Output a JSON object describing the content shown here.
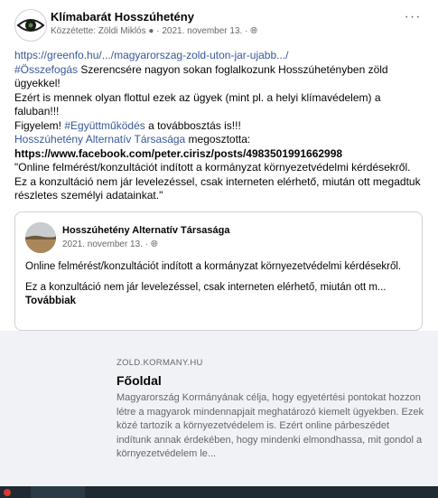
{
  "post": {
    "page_name": "Klímabarát Hosszúhetény",
    "meta_prefix": "Közzétette: ",
    "author": "Zöldi Miklós",
    "date": "2021. november 13.",
    "dot": " · ",
    "link_url": "https://greenfo.hu/.../magyarorszag-zold-uton-jar-ujabb.../",
    "hashtag1": "#Összefogás",
    "line1_rest": " Szerencsére nagyon sokan foglalkozunk Hosszúhetényben zöld ügyekkel!",
    "line2": "Ezért is mennek olyan flottul ezek az ügyek (mint pl. a helyi klímavédelem) a faluban!!!",
    "line3_pre": "Figyelem! ",
    "hashtag2": "#Együttműködés",
    "line3_post": " a továbbosztás is!!!",
    "share_page": "Hosszúhetény Alternatív Társasága",
    "share_suffix": " megosztotta:",
    "fb_link": "https://www.facebook.com/peter.cirisz/posts/4983501991662998",
    "quote": "\"Online felmérést/konzultációt indított a kormányzat környezetvédelmi kérdésekről. Ez a konzultáció nem jár levelezéssel, csak interneten elérhető, miután ott megadtuk részletes személyi adatainkat.\""
  },
  "shared": {
    "name": "Hosszúhetény Alternatív Társasága",
    "date": "2021. november 13.",
    "dot": " · ",
    "para1": "Online felmérést/konzultációt indított a kormányzat környezetvédelmi kérdésekről.",
    "para2": "Ez a konzultáció nem jár levelezéssel, csak interneten elérhető, miután ott m...",
    "more": "Továbbiak"
  },
  "preview": {
    "domain": "ZOLD.KORMANY.HU",
    "title": "Főoldal",
    "description": "Magyarország Kormányának célja, hogy egyetértési pontokat hozzon létre a magyarok mindennapjait meghatározó kiemelt ügyekben. Ezek közé tartozik a környezetvédelem is. Ezért online párbeszédet indítunk annak érdekében, hogy mindenki elmondhassa, mit gondol a környezetvédelem le..."
  },
  "icons": {
    "more": "more-options-icon",
    "privacy": "globe-icon",
    "author_badge": "info-icon"
  },
  "colors": {
    "link": "#385898",
    "secondary_text": "#65676b",
    "preview_bg": "#f0f2f5"
  }
}
